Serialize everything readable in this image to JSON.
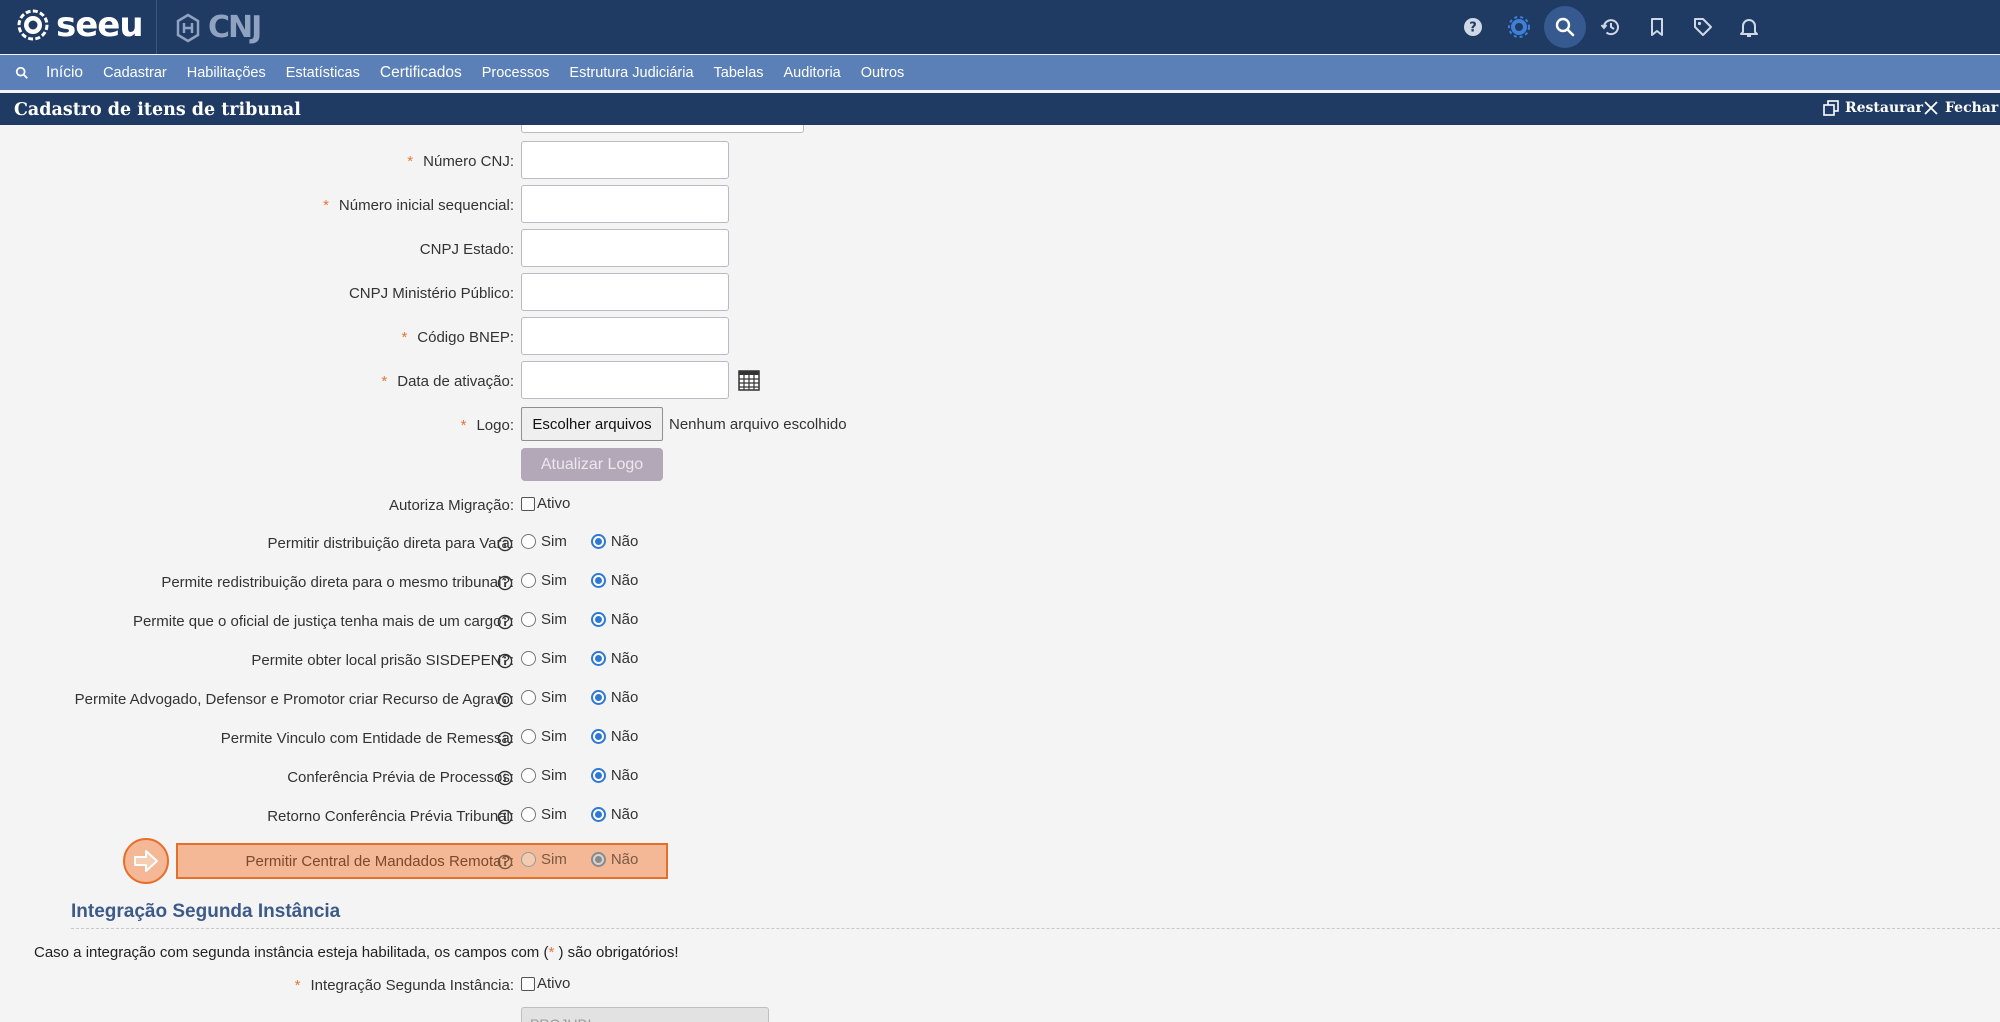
{
  "app": {
    "brand": "seeu",
    "partner": "CNJ"
  },
  "menu": {
    "items": [
      "Início",
      "Cadastrar",
      "Habilitações",
      "Estatísticas",
      "Certificados",
      "Processos",
      "Estrutura Judiciária",
      "Tabelas",
      "Auditoria",
      "Outros"
    ]
  },
  "window": {
    "title": "Cadastro de itens de tribunal",
    "restore_label": "Restaurar",
    "close_label": "Fechar"
  },
  "form": {
    "numero_cnj": {
      "label": "Número CNJ:",
      "required": "*",
      "value": ""
    },
    "numero_inicial": {
      "label": "Número inicial sequencial:",
      "required": "*",
      "value": ""
    },
    "cnpj_estado": {
      "label": "CNPJ Estado:",
      "value": ""
    },
    "cnpj_mp": {
      "label": "CNPJ Ministério Público:",
      "value": ""
    },
    "codigo_bnep": {
      "label": "Código BNEP:",
      "required": "*",
      "value": ""
    },
    "data_ativacao": {
      "label": "Data de ativação:",
      "required": "*",
      "value": ""
    },
    "logo": {
      "label": "Logo:",
      "required": "*",
      "choose_label": "Escolher arquivos",
      "no_file": "Nenhum arquivo escolhido",
      "update_label": "Atualizar Logo"
    },
    "autoriza_migracao": {
      "label": "Autoriza Migração:",
      "option": "Ativo",
      "checked": false
    },
    "yes_label": "Sim",
    "no_label": "Não",
    "radios": [
      {
        "label": "Permitir distribuição direta para Vara:",
        "value": "Não"
      },
      {
        "label": "Permite redistribuição direta para o mesmo tribunal?:",
        "value": "Não"
      },
      {
        "label": "Permite que o oficial de justiça tenha mais de um cargo?:",
        "value": "Não"
      },
      {
        "label": "Permite obter local prisão SISDEPEN?:",
        "value": "Não"
      },
      {
        "label": "Permite Advogado, Defensor e Promotor criar Recurso de Agravo:",
        "value": "Não"
      },
      {
        "label": "Permite Vinculo com Entidade de Remessa:",
        "value": "Não"
      },
      {
        "label": "Conferência Prévia de Processos:",
        "value": "Não"
      },
      {
        "label": "Retorno Conferência Prévia Tribunal:",
        "value": "Não"
      },
      {
        "label": "Permitir Central de Mandados Remota?:",
        "value": "Não",
        "highlighted": true
      }
    ]
  },
  "section2": {
    "title": "Integração Segunda Instância",
    "note_prefix": "Caso a integração com segunda instância esteja habilitada, os campos com (",
    "note_star": "*",
    "note_suffix": " ) são obrigatórios!",
    "integracao": {
      "label": "Integração Segunda Instância:",
      "required": "*",
      "option": "Ativo",
      "checked": false
    },
    "system_value": "PROJUDI"
  },
  "colors": {
    "topbar": "#1f3a63",
    "menubar": "#5b80b8",
    "required": "#e8773a",
    "highlight": "#f5b896",
    "radio_checked": "#2f79d6"
  }
}
